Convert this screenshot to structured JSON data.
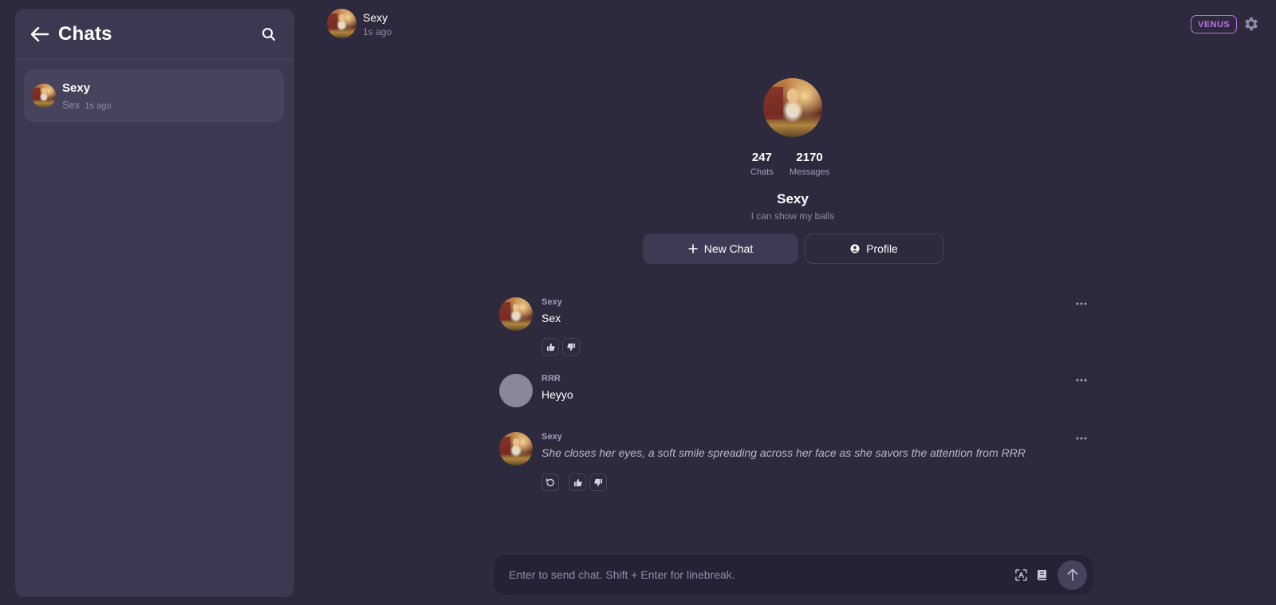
{
  "sidebar": {
    "title": "Chats",
    "chats": [
      {
        "name": "Sexy",
        "last_message": "Sex",
        "time": "1s ago"
      }
    ]
  },
  "header": {
    "name": "Sexy",
    "time": "1s ago",
    "badge": "VENUS"
  },
  "profile": {
    "stats": [
      {
        "value": "247",
        "label": "Chats"
      },
      {
        "value": "2170",
        "label": "Messages"
      }
    ],
    "name": "Sexy",
    "description": "I can show my balls",
    "new_chat_label": "New Chat",
    "profile_label": "Profile"
  },
  "messages": [
    {
      "author": "Sexy",
      "text": "Sex",
      "italic": false
    },
    {
      "author": "RRR",
      "text": "Heyyo",
      "italic": false
    },
    {
      "author": "Sexy",
      "text": "She closes her eyes, a soft smile spreading across her face as she savors the attention from RRR",
      "italic": true
    }
  ],
  "input": {
    "placeholder": "Enter to send chat. Shift + Enter for linebreak."
  },
  "colors": {
    "background": "#2d2a3e",
    "sidebar": "#3c3852",
    "accent": "#c36fe8"
  }
}
